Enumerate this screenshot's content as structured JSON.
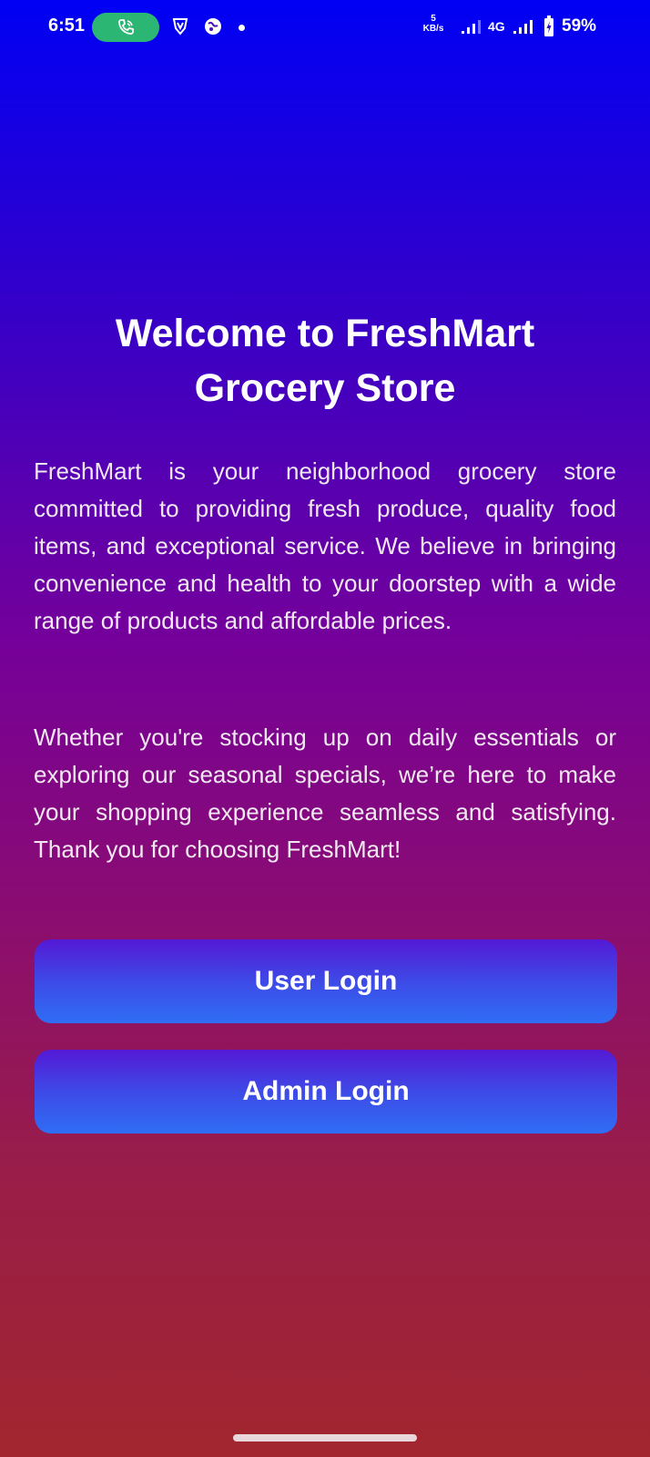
{
  "status_bar": {
    "time": "6:51",
    "net_speed_value": "5",
    "net_speed_unit": "KB/s",
    "network_type": "4G",
    "battery_percent": "59%",
    "call_pill_color": "#2BB673"
  },
  "icons": {
    "call": "phone-call-icon",
    "vpn": "shield-v-icon",
    "app": "globe-app-icon",
    "notification_dot": "dot-icon",
    "signal_1": "signal-icon",
    "signal_2": "signal-icon",
    "battery": "battery-icon"
  },
  "welcome": {
    "title": "Welcome to FreshMart Grocery Store",
    "paragraph_1": "FreshMart is your neighborhood grocery store committed to providing fresh produce, quality food items, and exceptional service. We believe in bringing convenience and health to your doorstep with a wide range of products and affordable prices.",
    "paragraph_2": "Whether you're stocking up on daily essentials or exploring our seasonal specials, we’re here to make your shopping experience seamless and satisfying. Thank you for choosing FreshMart!"
  },
  "buttons": {
    "user_login": "User Login",
    "admin_login": "Admin Login"
  },
  "colors": {
    "background_top": "#0000F4",
    "background_bottom": "#A2262E",
    "button_top": "#5419D6",
    "button_bottom": "#2F6EF5",
    "text": "#FFFFFF"
  }
}
